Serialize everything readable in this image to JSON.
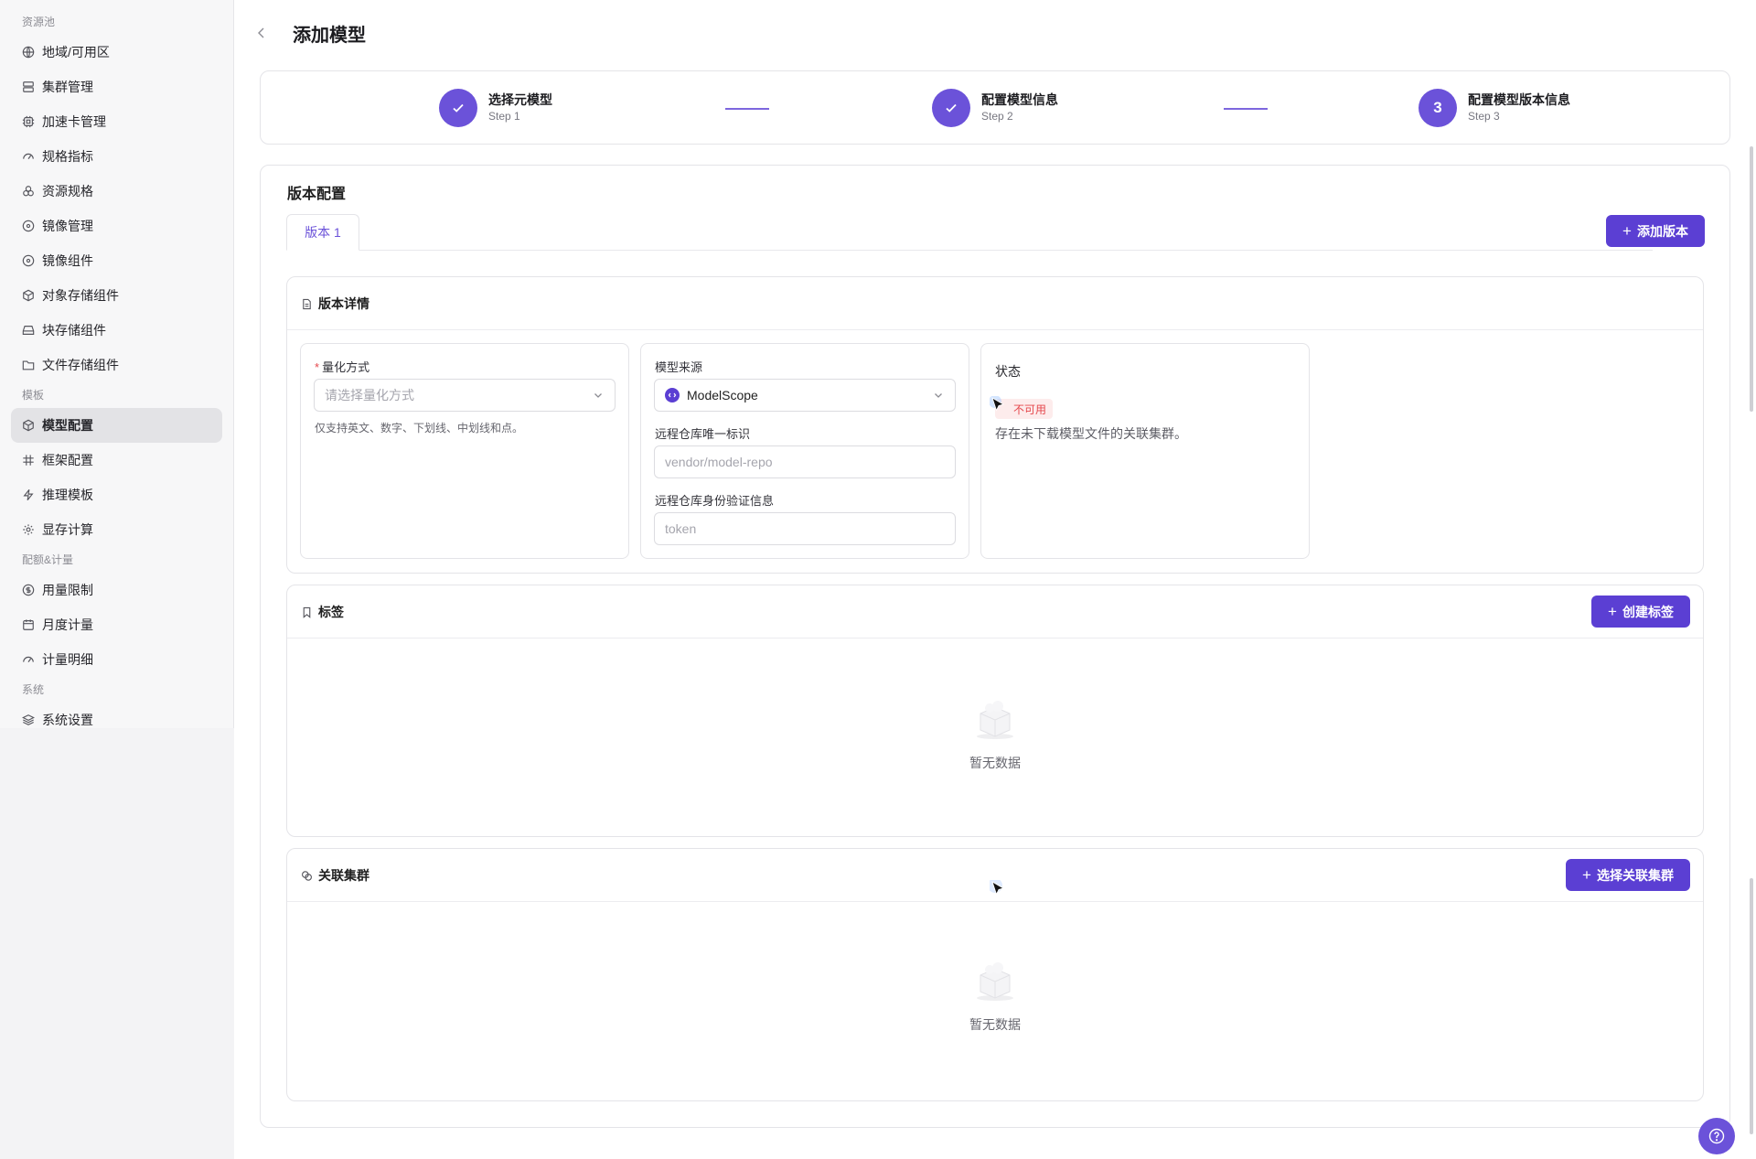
{
  "sidebar": {
    "groups": [
      {
        "title": "资源池",
        "items": [
          {
            "label": "地域/可用区",
            "icon": "globe-icon"
          },
          {
            "label": "集群管理",
            "icon": "server-icon"
          },
          {
            "label": "加速卡管理",
            "icon": "chip-icon"
          },
          {
            "label": "规格指标",
            "icon": "gauge-icon"
          },
          {
            "label": "资源规格",
            "icon": "boxes-icon"
          },
          {
            "label": "镜像管理",
            "icon": "disc-icon"
          },
          {
            "label": "镜像组件",
            "icon": "disc-icon"
          },
          {
            "label": "对象存储组件",
            "icon": "cube-icon"
          },
          {
            "label": "块存储组件",
            "icon": "hard-drive-icon"
          },
          {
            "label": "文件存储组件",
            "icon": "folder-icon"
          }
        ]
      },
      {
        "title": "模板",
        "items": [
          {
            "label": "模型配置",
            "icon": "cube-icon",
            "active": true
          },
          {
            "label": "框架配置",
            "icon": "hash-icon"
          },
          {
            "label": "推理模板",
            "icon": "zap-icon"
          },
          {
            "label": "显存计算",
            "icon": "gear-icon"
          }
        ]
      },
      {
        "title": "配额&计量",
        "items": [
          {
            "label": "用量限制",
            "icon": "dollar-icon"
          },
          {
            "label": "月度计量",
            "icon": "calendar-icon"
          },
          {
            "label": "计量明细",
            "icon": "gauge-icon"
          }
        ]
      },
      {
        "title": "系统",
        "items": [
          {
            "label": "系统设置",
            "icon": "layers-icon"
          }
        ]
      }
    ]
  },
  "header": {
    "title": "添加模型"
  },
  "steps": [
    {
      "title": "选择元模型",
      "sub": "Step 1",
      "state": "done"
    },
    {
      "title": "配置模型信息",
      "sub": "Step 2",
      "state": "done"
    },
    {
      "title": "配置模型版本信息",
      "sub": "Step 3",
      "state": "current",
      "number": "3"
    }
  ],
  "config": {
    "title": "版本配置",
    "tab_label": "版本 1",
    "add_version_label": "添加版本"
  },
  "version_detail": {
    "title": "版本详情",
    "quant_label": "量化方式",
    "quant_placeholder": "请选择量化方式",
    "quant_hint": "仅支持英文、数字、下划线、中划线和点。",
    "source_label": "模型来源",
    "source_value": "ModelScope",
    "repo_id_label": "远程仓库唯一标识",
    "repo_id_placeholder": "vendor/model-repo",
    "repo_auth_label": "远程仓库身份验证信息",
    "repo_auth_placeholder": "token",
    "status_label": "状态",
    "status_badge": "不可用",
    "status_desc": "存在未下载模型文件的关联集群。"
  },
  "tags": {
    "title": "标签",
    "create_label": "创建标签",
    "empty_text": "暂无数据"
  },
  "clusters": {
    "title": "关联集群",
    "select_label": "选择关联集群",
    "empty_text": "暂无数据"
  },
  "colors": {
    "primary": "#5b3fd3",
    "step": "#6b52d9",
    "danger": "#e5484d"
  }
}
